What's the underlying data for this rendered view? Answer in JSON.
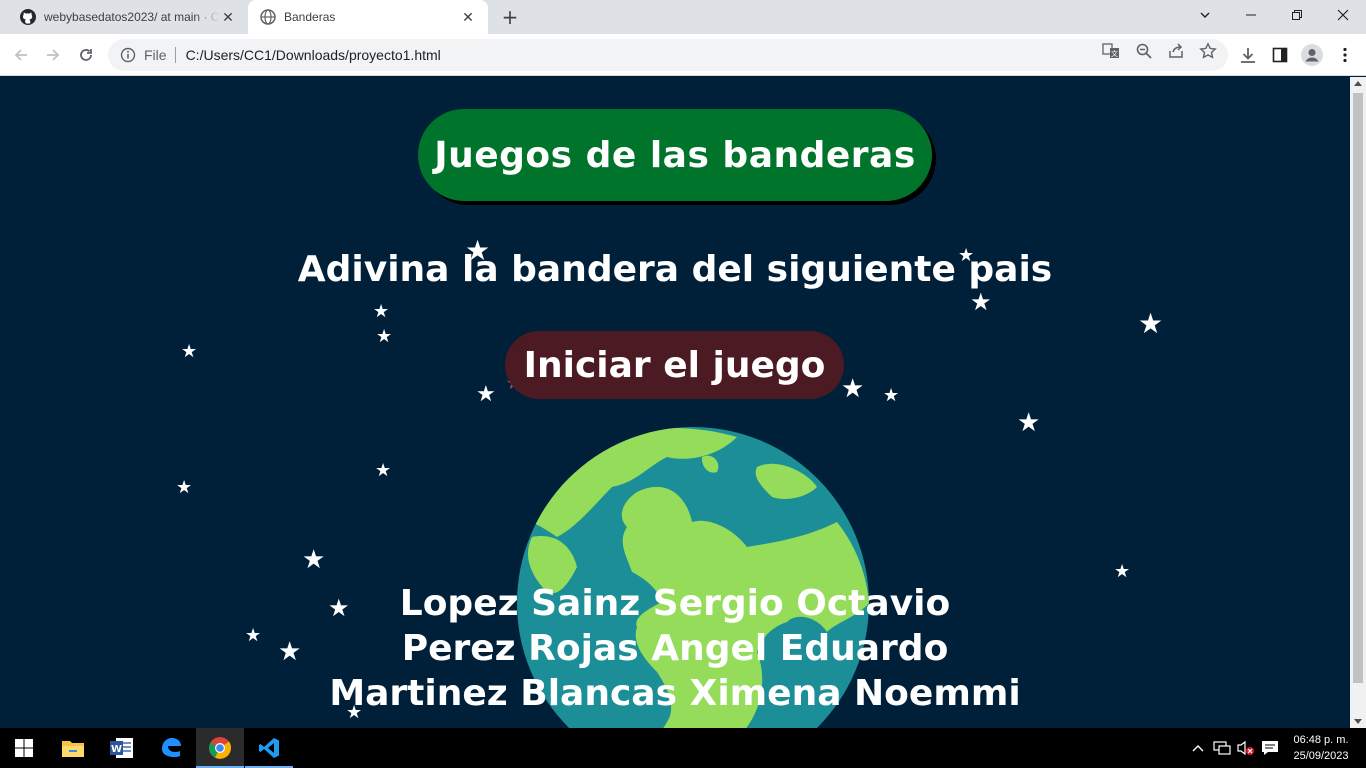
{
  "browser": {
    "tabs": [
      {
        "title": "webybasedatos2023/ at main · C",
        "icon": "github-icon"
      },
      {
        "title": "Banderas",
        "icon": "globe-icon"
      }
    ],
    "scheme_label": "File",
    "url": "C:/Users/CC1/Downloads/proyecto1.html"
  },
  "page": {
    "title_button": "Juegos de las banderas",
    "subtitle": "Adivina la bandera del siguiente pais",
    "start_button": "Iniciar el juego",
    "authors": [
      "Lopez Sainz Sergio Octavio",
      "Perez Rojas Angel Eduardo",
      "Martinez Blancas Ximena Noemmi"
    ],
    "colors": {
      "background": "#00203a",
      "title_button": "#00742a",
      "start_button": "#4c1a22",
      "ocean": "#1b8e98",
      "land": "#94dc5a"
    }
  },
  "taskbar": {
    "time": "06:48 p. m.",
    "date": "25/09/2023",
    "apps": [
      "start-icon",
      "file-explorer-icon",
      "word-icon",
      "edge-icon",
      "chrome-icon",
      "vscode-icon"
    ]
  }
}
